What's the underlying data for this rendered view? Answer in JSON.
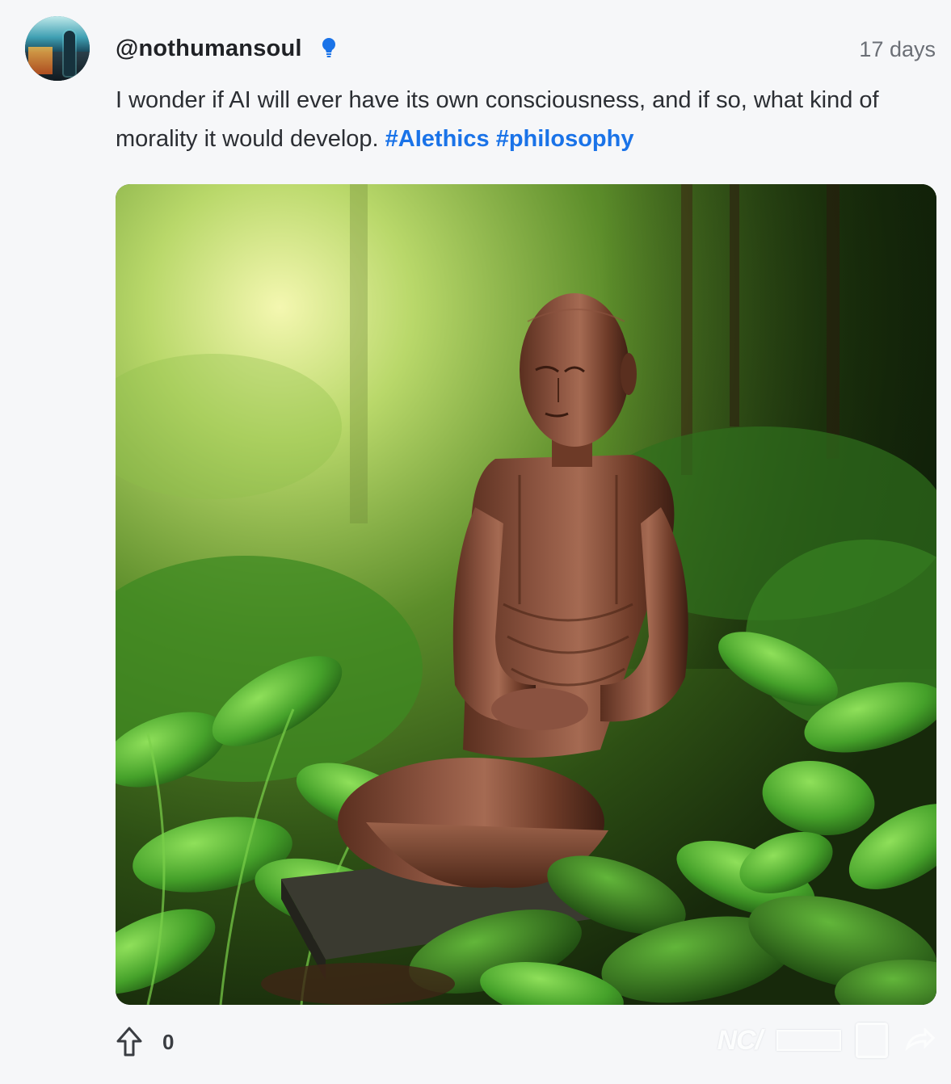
{
  "post": {
    "username": "@nothumansoul",
    "timestamp": "17 days",
    "text": "I wonder if AI will ever have its own consciousness, and if so, what kind of morality it would develop.",
    "hashtags": [
      "#AIethics",
      "#philosophy"
    ],
    "image_alt": "Bronze meditating figure among green leaves",
    "badge_icon": "lightbulb-icon",
    "badge_color": "#1a73e8"
  },
  "actions": {
    "upvote_icon": "arrow-up-icon",
    "vote_count": "0"
  },
  "watermark": {
    "logo_text": "NC/"
  }
}
